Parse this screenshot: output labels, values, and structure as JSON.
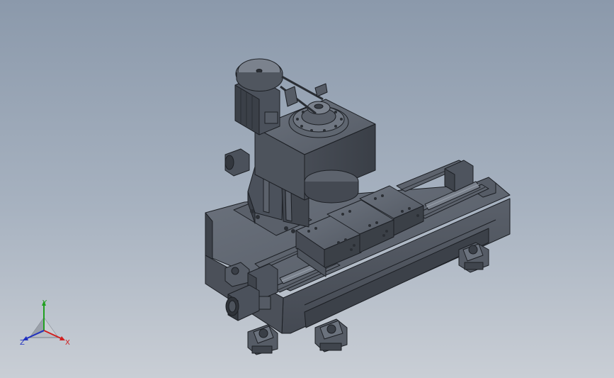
{
  "viewport": {
    "background_top": "#8b99ab",
    "background_bottom": "#c9ced5"
  },
  "model": {
    "render_style": "shaded-with-edges",
    "base_color": "#4a505a",
    "edge_color": "#1c1f24",
    "highlight_color": "#6b727d",
    "components": [
      "motor-pulley-drive",
      "spindle-head",
      "support-column",
      "sliding-table",
      "linear-guide-rails",
      "ball-screw",
      "servo-motor",
      "machine-base",
      "leveling-feet"
    ]
  },
  "triad": {
    "x_label": "X",
    "y_label": "Y",
    "z_label": "Z",
    "x_color": "#d02020",
    "y_color": "#20a020",
    "z_color": "#2030c0"
  }
}
